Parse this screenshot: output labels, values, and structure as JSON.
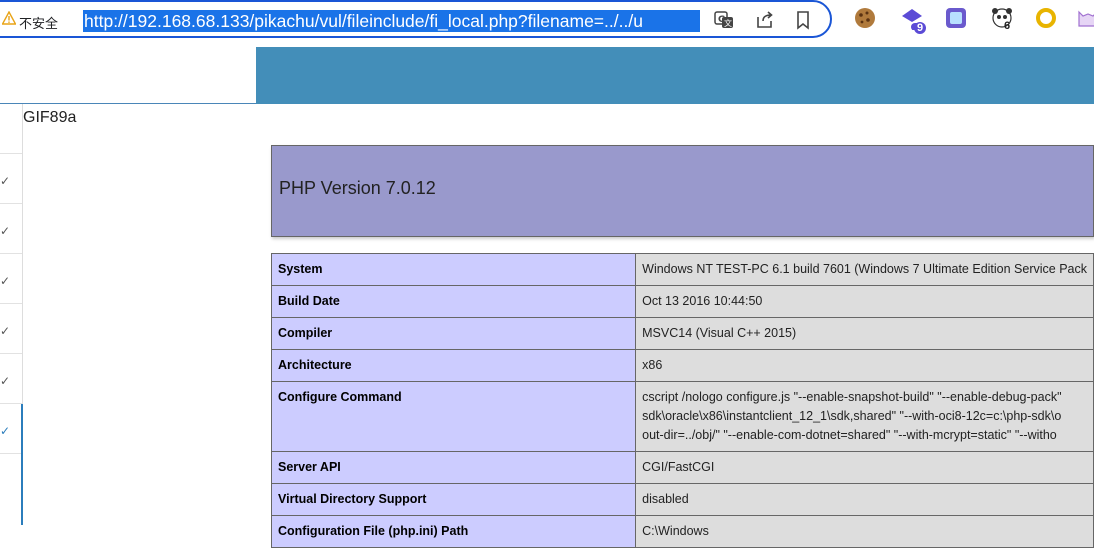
{
  "browser": {
    "security_label": "不安全",
    "url": "http://192.168.68.133/pikachu/vul/fileinclude/fi_local.php?filename=../../u",
    "extensions": [
      {
        "name": "cookie-extension-icon"
      },
      {
        "name": "graduation-extension-icon",
        "badge": "9"
      },
      {
        "name": "window-extension-icon"
      },
      {
        "name": "panda-extension-icon",
        "badge": "6"
      },
      {
        "name": "ring-extension-icon"
      },
      {
        "name": "cat-extension-icon"
      }
    ]
  },
  "page": {
    "gif_header": "GIF89a",
    "php_version_title": "PHP Version 7.0.12",
    "info_rows": [
      {
        "key": "System",
        "value": "Windows NT TEST-PC 6.1 build 7601 (Windows 7 Ultimate Edition Service Pack"
      },
      {
        "key": "Build Date",
        "value": "Oct 13 2016 10:44:50"
      },
      {
        "key": "Compiler",
        "value": "MSVC14 (Visual C++ 2015)"
      },
      {
        "key": "Architecture",
        "value": "x86"
      },
      {
        "key": "Configure Command",
        "value_lines": [
          "cscript /nologo configure.js \"--enable-snapshot-build\" \"--enable-debug-pack\"",
          "sdk\\oracle\\x86\\instantclient_12_1\\sdk,shared\" \"--with-oci8-12c=c:\\php-sdk\\o",
          "out-dir=../obj/\" \"--enable-com-dotnet=shared\" \"--with-mcrypt=static\" \"--witho"
        ]
      },
      {
        "key": "Server API",
        "value": "CGI/FastCGI"
      },
      {
        "key": "Virtual Directory Support",
        "value": "disabled"
      },
      {
        "key": "Configuration File (php.ini) Path",
        "value": "C:\\Windows"
      }
    ]
  },
  "sidebar": {
    "row_count": 7,
    "check_glyph": "✓"
  },
  "colors": {
    "topbar": "#438eb9",
    "php_header": "#9999cc",
    "key_cell": "#ccccff",
    "value_cell": "#dddddd",
    "url_highlight": "#1a73e8"
  }
}
